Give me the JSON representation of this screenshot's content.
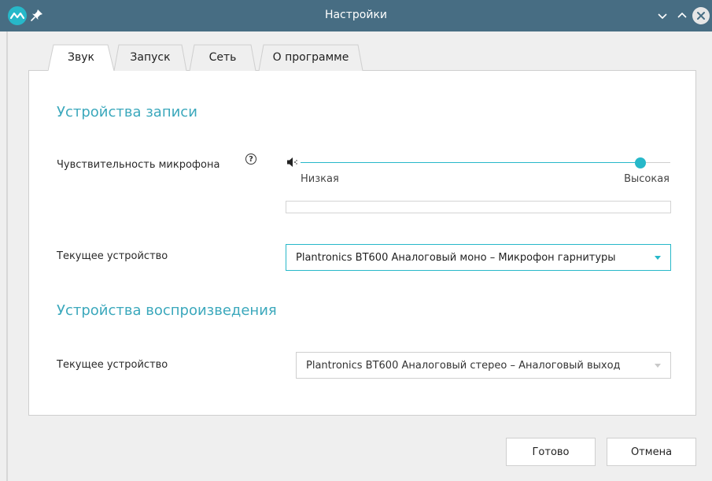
{
  "window": {
    "title": "Настройки",
    "accent_color": "#27b8c9",
    "titlebar_color": "#476d83"
  },
  "titlebar_icons": [
    "app-logo-icon",
    "pin-icon",
    "chevron-down-icon",
    "chevron-up-icon",
    "close-icon"
  ],
  "tabs": [
    {
      "label": "Звук",
      "active": true
    },
    {
      "label": "Запуск",
      "active": false
    },
    {
      "label": "Сеть",
      "active": false
    },
    {
      "label": "О программе",
      "active": false
    }
  ],
  "recording": {
    "section_title": "Устройства записи",
    "sensitivity_label": "Чувствительность микрофона",
    "help_glyph": "?",
    "slider": {
      "value_fraction": 0.92,
      "low_label": "Низкая",
      "high_label": "Высокая",
      "icon": "speaker-icon"
    },
    "level_meter_fraction": 0,
    "device_label": "Текущее устройство",
    "device_value": "Plantronics BT600 Аналоговый моно – Микрофон гарнитуры"
  },
  "playback": {
    "section_title": "Устройства воспроизведения",
    "device_label": "Текущее устройство",
    "device_value": "Plantronics BT600 Аналоговый стерео – Аналоговый выход"
  },
  "buttons": {
    "done": "Готово",
    "cancel": "Отмена"
  }
}
